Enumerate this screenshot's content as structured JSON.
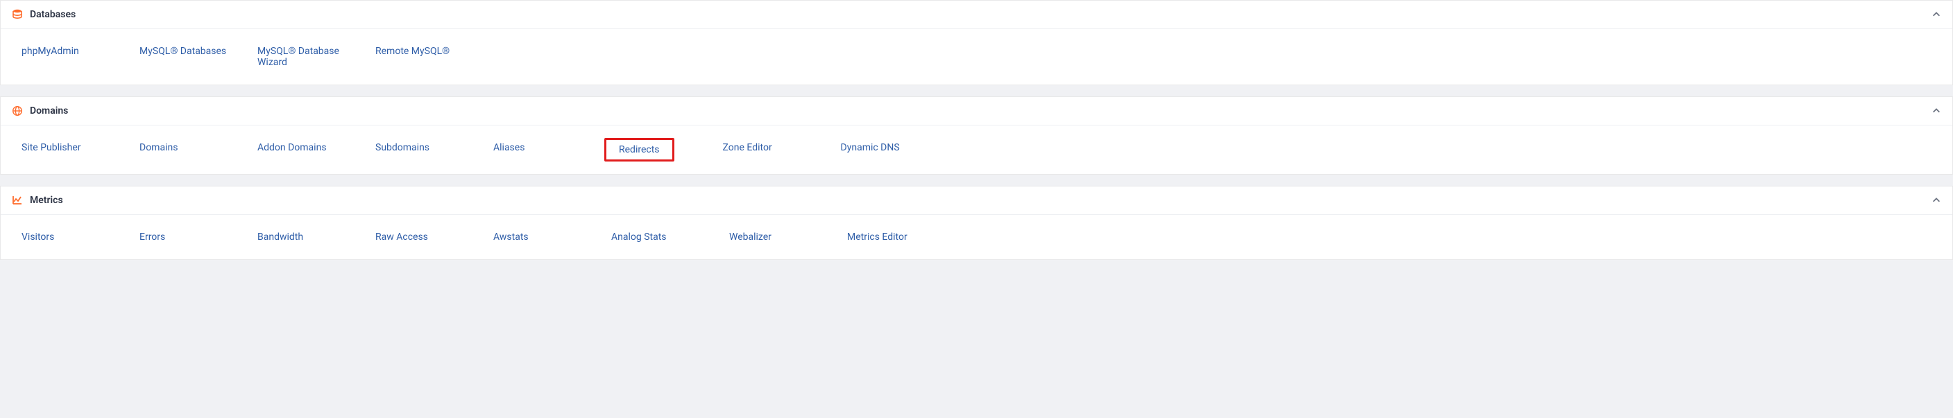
{
  "sections": [
    {
      "id": "databases",
      "title": "Databases",
      "icon": "database",
      "items": [
        {
          "label": "phpMyAdmin"
        },
        {
          "label": "MySQL® Databases"
        },
        {
          "label": "MySQL® Database Wizard"
        },
        {
          "label": "Remote MySQL®"
        }
      ]
    },
    {
      "id": "domains",
      "title": "Domains",
      "icon": "globe",
      "items": [
        {
          "label": "Site Publisher"
        },
        {
          "label": "Domains"
        },
        {
          "label": "Addon Domains"
        },
        {
          "label": "Subdomains"
        },
        {
          "label": "Aliases"
        },
        {
          "label": "Redirects",
          "highlight": true
        },
        {
          "label": "Zone Editor"
        },
        {
          "label": "Dynamic DNS"
        }
      ]
    },
    {
      "id": "metrics",
      "title": "Metrics",
      "icon": "chart",
      "items": [
        {
          "label": "Visitors"
        },
        {
          "label": "Errors"
        },
        {
          "label": "Bandwidth"
        },
        {
          "label": "Raw Access"
        },
        {
          "label": "Awstats"
        },
        {
          "label": "Analog Stats"
        },
        {
          "label": "Webalizer"
        },
        {
          "label": "Metrics Editor"
        }
      ]
    }
  ]
}
